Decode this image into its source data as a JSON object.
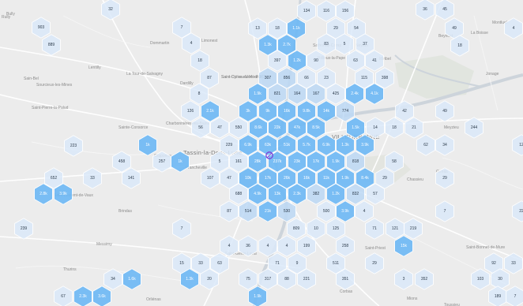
{
  "map": {
    "places": [
      {
        "id": "rully",
        "text": "Rully"
      },
      {
        "id": "bully",
        "text": "Bully"
      },
      {
        "id": "lentilly",
        "text": "Lentilly"
      },
      {
        "id": "dommartin",
        "text": "Dommartin"
      },
      {
        "id": "limonest",
        "text": "Limonest"
      },
      {
        "id": "saint-cyr",
        "text": "Saint-Cyr-au-Mont-d'Or"
      },
      {
        "id": "sain-bel",
        "text": "Sain-Bel"
      },
      {
        "id": "sourcieux",
        "text": "Sourcieux-les-Mines"
      },
      {
        "id": "tour-salvagny",
        "text": "La Tour-de-Salvagny"
      },
      {
        "id": "dardilly",
        "text": "Dardilly"
      },
      {
        "id": "saint-didier",
        "text": "Saint-Didier-au-Mont-d'Or"
      },
      {
        "id": "saint-pierre-palud",
        "text": "Saint-Pierre-la-Palud"
      },
      {
        "id": "sainte-consorce",
        "text": "Sainte-Consorce"
      },
      {
        "id": "charbonnieres",
        "text": "Charbonnières-les-Bains"
      },
      {
        "id": "tassin",
        "text": "Tassin-la-Demi-Lune"
      },
      {
        "id": "craponne",
        "text": "Craponne"
      },
      {
        "id": "francheville",
        "text": "Francheville"
      },
      {
        "id": "brindas",
        "text": "Brindas"
      },
      {
        "id": "saint-laurent-vaux",
        "text": "Saint-Laurent-de-Vaux"
      },
      {
        "id": "messimy",
        "text": "Messimy"
      },
      {
        "id": "thurins",
        "text": "Thurins"
      },
      {
        "id": "orliénas",
        "text": "Orliénas"
      },
      {
        "id": "villeurbanne",
        "text": "VILLEURBANNE"
      },
      {
        "id": "rillieux",
        "text": "Rillieux-la-Pape"
      },
      {
        "id": "miribel",
        "text": "Miribel"
      },
      {
        "id": "neyron",
        "text": "Neyron"
      },
      {
        "id": "beynost",
        "text": "Beynost"
      },
      {
        "id": "la-boisse",
        "text": "La Boisse"
      },
      {
        "id": "montluel",
        "text": "Montluel"
      },
      {
        "id": "jonage",
        "text": "Jonage"
      },
      {
        "id": "meyzieu",
        "text": "Meyzieu"
      },
      {
        "id": "chassieu",
        "text": "Chassieu"
      },
      {
        "id": "genas",
        "text": "Genas"
      },
      {
        "id": "saint-priest",
        "text": "Saint-Priest"
      },
      {
        "id": "saint-bonnet",
        "text": "Saint-Bonnet-de-Mure"
      },
      {
        "id": "mions",
        "text": "Mions"
      },
      {
        "id": "corbas",
        "text": "Corbas"
      },
      {
        "id": "toussieu",
        "text": "Toussieu"
      },
      {
        "id": "sathonay",
        "text": "Sathonay-Camp"
      },
      {
        "id": "saint-genis",
        "text": "Saint-Genis-Laval"
      }
    ],
    "hexes": [
      {
        "label": "32",
        "tier": 1
      },
      {
        "label": "134",
        "tier": 1
      },
      {
        "label": "116",
        "tier": 1
      },
      {
        "label": "156",
        "tier": 1
      },
      {
        "label": "36",
        "tier": 1
      },
      {
        "label": "45",
        "tier": 1
      },
      {
        "label": "903",
        "tier": 1
      },
      {
        "label": "889",
        "tier": 1
      },
      {
        "label": "7",
        "tier": 1
      },
      {
        "label": "4",
        "tier": 1
      },
      {
        "label": "13",
        "tier": 1
      },
      {
        "label": "18",
        "tier": 1
      },
      {
        "label": "1.1k",
        "tier": 3
      },
      {
        "label": "29",
        "tier": 1
      },
      {
        "label": "54",
        "tier": 1
      },
      {
        "label": "49",
        "tier": 1
      },
      {
        "label": "4",
        "tier": 1
      },
      {
        "label": "1.3k",
        "tier": 3
      },
      {
        "label": "2.7k",
        "tier": 3
      },
      {
        "label": "83",
        "tier": 1
      },
      {
        "label": "5",
        "tier": 1
      },
      {
        "label": "37",
        "tier": 1
      },
      {
        "label": "18",
        "tier": 1
      },
      {
        "label": "18",
        "tier": 1
      },
      {
        "label": "397",
        "tier": 1
      },
      {
        "label": "1.2k",
        "tier": 3
      },
      {
        "label": "90",
        "tier": 1
      },
      {
        "label": "63",
        "tier": 1
      },
      {
        "label": "41",
        "tier": 1
      },
      {
        "label": "87",
        "tier": 1
      },
      {
        "label": "307",
        "tier": 2
      },
      {
        "label": "856",
        "tier": 2
      },
      {
        "label": "66",
        "tier": 1
      },
      {
        "label": "23",
        "tier": 1
      },
      {
        "label": "115",
        "tier": 1
      },
      {
        "label": "398",
        "tier": 1
      },
      {
        "label": "8",
        "tier": 1
      },
      {
        "label": "1.9k",
        "tier": 3
      },
      {
        "label": "821",
        "tier": 2
      },
      {
        "label": "164",
        "tier": 2
      },
      {
        "label": "167",
        "tier": 2
      },
      {
        "label": "425",
        "tier": 1
      },
      {
        "label": "2.4k",
        "tier": 3
      },
      {
        "label": "4.1k",
        "tier": 3
      },
      {
        "label": "126",
        "tier": 1
      },
      {
        "label": "2.1k",
        "tier": 3
      },
      {
        "label": "3k",
        "tier": 3
      },
      {
        "label": "9k",
        "tier": 3
      },
      {
        "label": "16k",
        "tier": 3
      },
      {
        "label": "9.8k",
        "tier": 3
      },
      {
        "label": "14k",
        "tier": 3
      },
      {
        "label": "774",
        "tier": 2
      },
      {
        "label": "42",
        "tier": 1
      },
      {
        "label": "49",
        "tier": 1
      },
      {
        "label": "56",
        "tier": 1
      },
      {
        "label": "47",
        "tier": 1
      },
      {
        "label": "550",
        "tier": 1
      },
      {
        "label": "8.6k",
        "tier": 3
      },
      {
        "label": "22k",
        "tier": 3
      },
      {
        "label": "47k",
        "tier": 3
      },
      {
        "label": "8.5k",
        "tier": 3
      },
      {
        "label": "1.5k",
        "tier": 3
      },
      {
        "label": "14",
        "tier": 1
      },
      {
        "label": "18",
        "tier": 1
      },
      {
        "label": "21",
        "tier": 1
      },
      {
        "label": "244",
        "tier": 1
      },
      {
        "label": "223",
        "tier": 1
      },
      {
        "label": "1k",
        "tier": 3
      },
      {
        "label": "229",
        "tier": 1
      },
      {
        "label": "6.9k",
        "tier": 3
      },
      {
        "label": "63k",
        "tier": 3
      },
      {
        "label": "51k",
        "tier": 3
      },
      {
        "label": "5.7k",
        "tier": 3
      },
      {
        "label": "6.9k",
        "tier": 3
      },
      {
        "label": "1.3k",
        "tier": 3
      },
      {
        "label": "3.9k",
        "tier": 3
      },
      {
        "label": "62",
        "tier": 1
      },
      {
        "label": "34",
        "tier": 1
      },
      {
        "label": "12",
        "tier": 1
      },
      {
        "label": "458",
        "tier": 1
      },
      {
        "label": "257",
        "tier": 1
      },
      {
        "label": "1k",
        "tier": 3
      },
      {
        "label": "5",
        "tier": 1
      },
      {
        "label": "161",
        "tier": 1
      },
      {
        "label": "28k",
        "tier": 3
      },
      {
        "label": "237k",
        "tier": 3
      },
      {
        "label": "23k",
        "tier": 3
      },
      {
        "label": "17k",
        "tier": 3
      },
      {
        "label": "1.9k",
        "tier": 3
      },
      {
        "label": "818",
        "tier": 2
      },
      {
        "label": "58",
        "tier": 1
      },
      {
        "label": "652",
        "tier": 1
      },
      {
        "label": "33",
        "tier": 1
      },
      {
        "label": "141",
        "tier": 1
      },
      {
        "label": "107",
        "tier": 1
      },
      {
        "label": "47",
        "tier": 1
      },
      {
        "label": "10k",
        "tier": 3
      },
      {
        "label": "17k",
        "tier": 3
      },
      {
        "label": "26k",
        "tier": 3
      },
      {
        "label": "16k",
        "tier": 3
      },
      {
        "label": "11k",
        "tier": 3
      },
      {
        "label": "1.9k",
        "tier": 3
      },
      {
        "label": "8.4k",
        "tier": 3
      },
      {
        "label": "29",
        "tier": 1
      },
      {
        "label": "29",
        "tier": 1
      },
      {
        "label": "2.8k",
        "tier": 3
      },
      {
        "label": "3.9k",
        "tier": 3
      },
      {
        "label": "688",
        "tier": 1
      },
      {
        "label": "4.9k",
        "tier": 3
      },
      {
        "label": "13k",
        "tier": 3
      },
      {
        "label": "2.3k",
        "tier": 3
      },
      {
        "label": "382",
        "tier": 2
      },
      {
        "label": "1.2k",
        "tier": 3
      },
      {
        "label": "832",
        "tier": 2
      },
      {
        "label": "57",
        "tier": 1
      },
      {
        "label": "87",
        "tier": 1
      },
      {
        "label": "514",
        "tier": 2
      },
      {
        "label": "21k",
        "tier": 3
      },
      {
        "label": "530",
        "tier": 2
      },
      {
        "label": "500",
        "tier": 1
      },
      {
        "label": "3.9k",
        "tier": 3
      },
      {
        "label": "4",
        "tier": 1
      },
      {
        "label": "7",
        "tier": 1
      },
      {
        "label": "22",
        "tier": 1
      },
      {
        "label": "239",
        "tier": 1
      },
      {
        "label": "7",
        "tier": 1
      },
      {
        "label": "809",
        "tier": 1
      },
      {
        "label": "10",
        "tier": 1
      },
      {
        "label": "125",
        "tier": 1
      },
      {
        "label": "71",
        "tier": 1
      },
      {
        "label": "121",
        "tier": 1
      },
      {
        "label": "219",
        "tier": 1
      },
      {
        "label": "4",
        "tier": 1
      },
      {
        "label": "36",
        "tier": 1
      },
      {
        "label": "4",
        "tier": 1
      },
      {
        "label": "4",
        "tier": 1
      },
      {
        "label": "199",
        "tier": 1
      },
      {
        "label": "258",
        "tier": 1
      },
      {
        "label": "15k",
        "tier": 3
      },
      {
        "label": "15",
        "tier": 1
      },
      {
        "label": "33",
        "tier": 1
      },
      {
        "label": "63",
        "tier": 1
      },
      {
        "label": "71",
        "tier": 1
      },
      {
        "label": "9",
        "tier": 1
      },
      {
        "label": "511",
        "tier": 1
      },
      {
        "label": "29",
        "tier": 1
      },
      {
        "label": "92",
        "tier": 1
      },
      {
        "label": "33",
        "tier": 1
      },
      {
        "label": "34",
        "tier": 1
      },
      {
        "label": "1.6k",
        "tier": 3
      },
      {
        "label": "1.3k",
        "tier": 3
      },
      {
        "label": "20",
        "tier": 1
      },
      {
        "label": "75",
        "tier": 1
      },
      {
        "label": "317",
        "tier": 1
      },
      {
        "label": "88",
        "tier": 1
      },
      {
        "label": "221",
        "tier": 1
      },
      {
        "label": "351",
        "tier": 1
      },
      {
        "label": "3",
        "tier": 1
      },
      {
        "label": "352",
        "tier": 1
      },
      {
        "label": "103",
        "tier": 1
      },
      {
        "label": "30",
        "tier": 1
      },
      {
        "label": "67",
        "tier": 1
      },
      {
        "label": "2.3k",
        "tier": 3
      },
      {
        "label": "3.6k",
        "tier": 3
      },
      {
        "label": "1.9k",
        "tier": 3
      },
      {
        "label": "189",
        "tier": 1
      },
      {
        "label": "7",
        "tier": 1
      },
      {
        "label": "61",
        "tier": 1
      }
    ],
    "colors": {
      "background": "#ececec",
      "tier1": "#dbe9f9",
      "tier2": "#bcd8f5",
      "tier3": "#6fb8f4",
      "hexOutline": "#ffffff",
      "marker": "#7b3fd8",
      "roads": "#ffffff",
      "river": "#cdd4db",
      "park": "#dfe3dc"
    },
    "marker": {
      "name": "location-marker-icon"
    }
  }
}
